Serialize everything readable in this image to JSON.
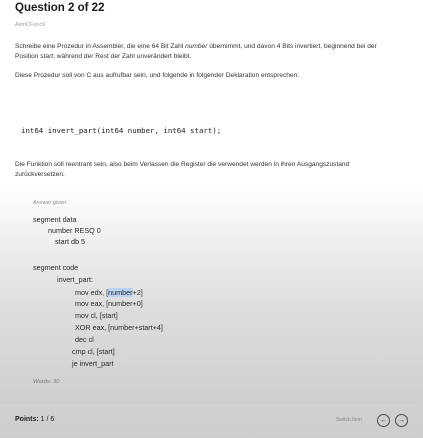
{
  "question": {
    "title": "Question 2 of 22",
    "code": "AsmCFunc6"
  },
  "prompt": {
    "p1_a": "Schreibe eine Prozedur in Assembler, die eine 64 Bit Zahl ",
    "p1_em1": "number",
    "p1_b": " übernimmt, und davon 4 Bits invertiert, beginnend bei der Position ",
    "p1_em2": "start",
    "p1_c": ", während der Rest der Zahl unverändert bleibt.",
    "p2": "Diese Prozedur soll von C aus aufrufbar sein, und folgende in folgender Deklaration entsprechen:",
    "declaration": "int64 invert_part(int64 number, int64 start);",
    "p3": "Die Funktion soll reentrant sein, also beim Verlassen die Register die verwendet werden in ihren Ausgangszustand zurückversetzen."
  },
  "answer": {
    "label": "Answer given",
    "lines": [
      "segment data",
      "number RESQ 0",
      "start db 5",
      "segment code",
      "invert_part:",
      "mov edx, [",
      "number",
      "+2]",
      "mov eax, [number+0]",
      "mov cl, [start]",
      "XOR eax, [number+start+4]",
      "dec cl",
      "cmp cl, [start]",
      "je invert_part"
    ],
    "words": "Words: 30"
  },
  "footer": {
    "points_label": "Points:",
    "points_value": " 1 / 6",
    "switch_label": "Switch Item",
    "prev_icon": "←",
    "next_icon": "→"
  }
}
